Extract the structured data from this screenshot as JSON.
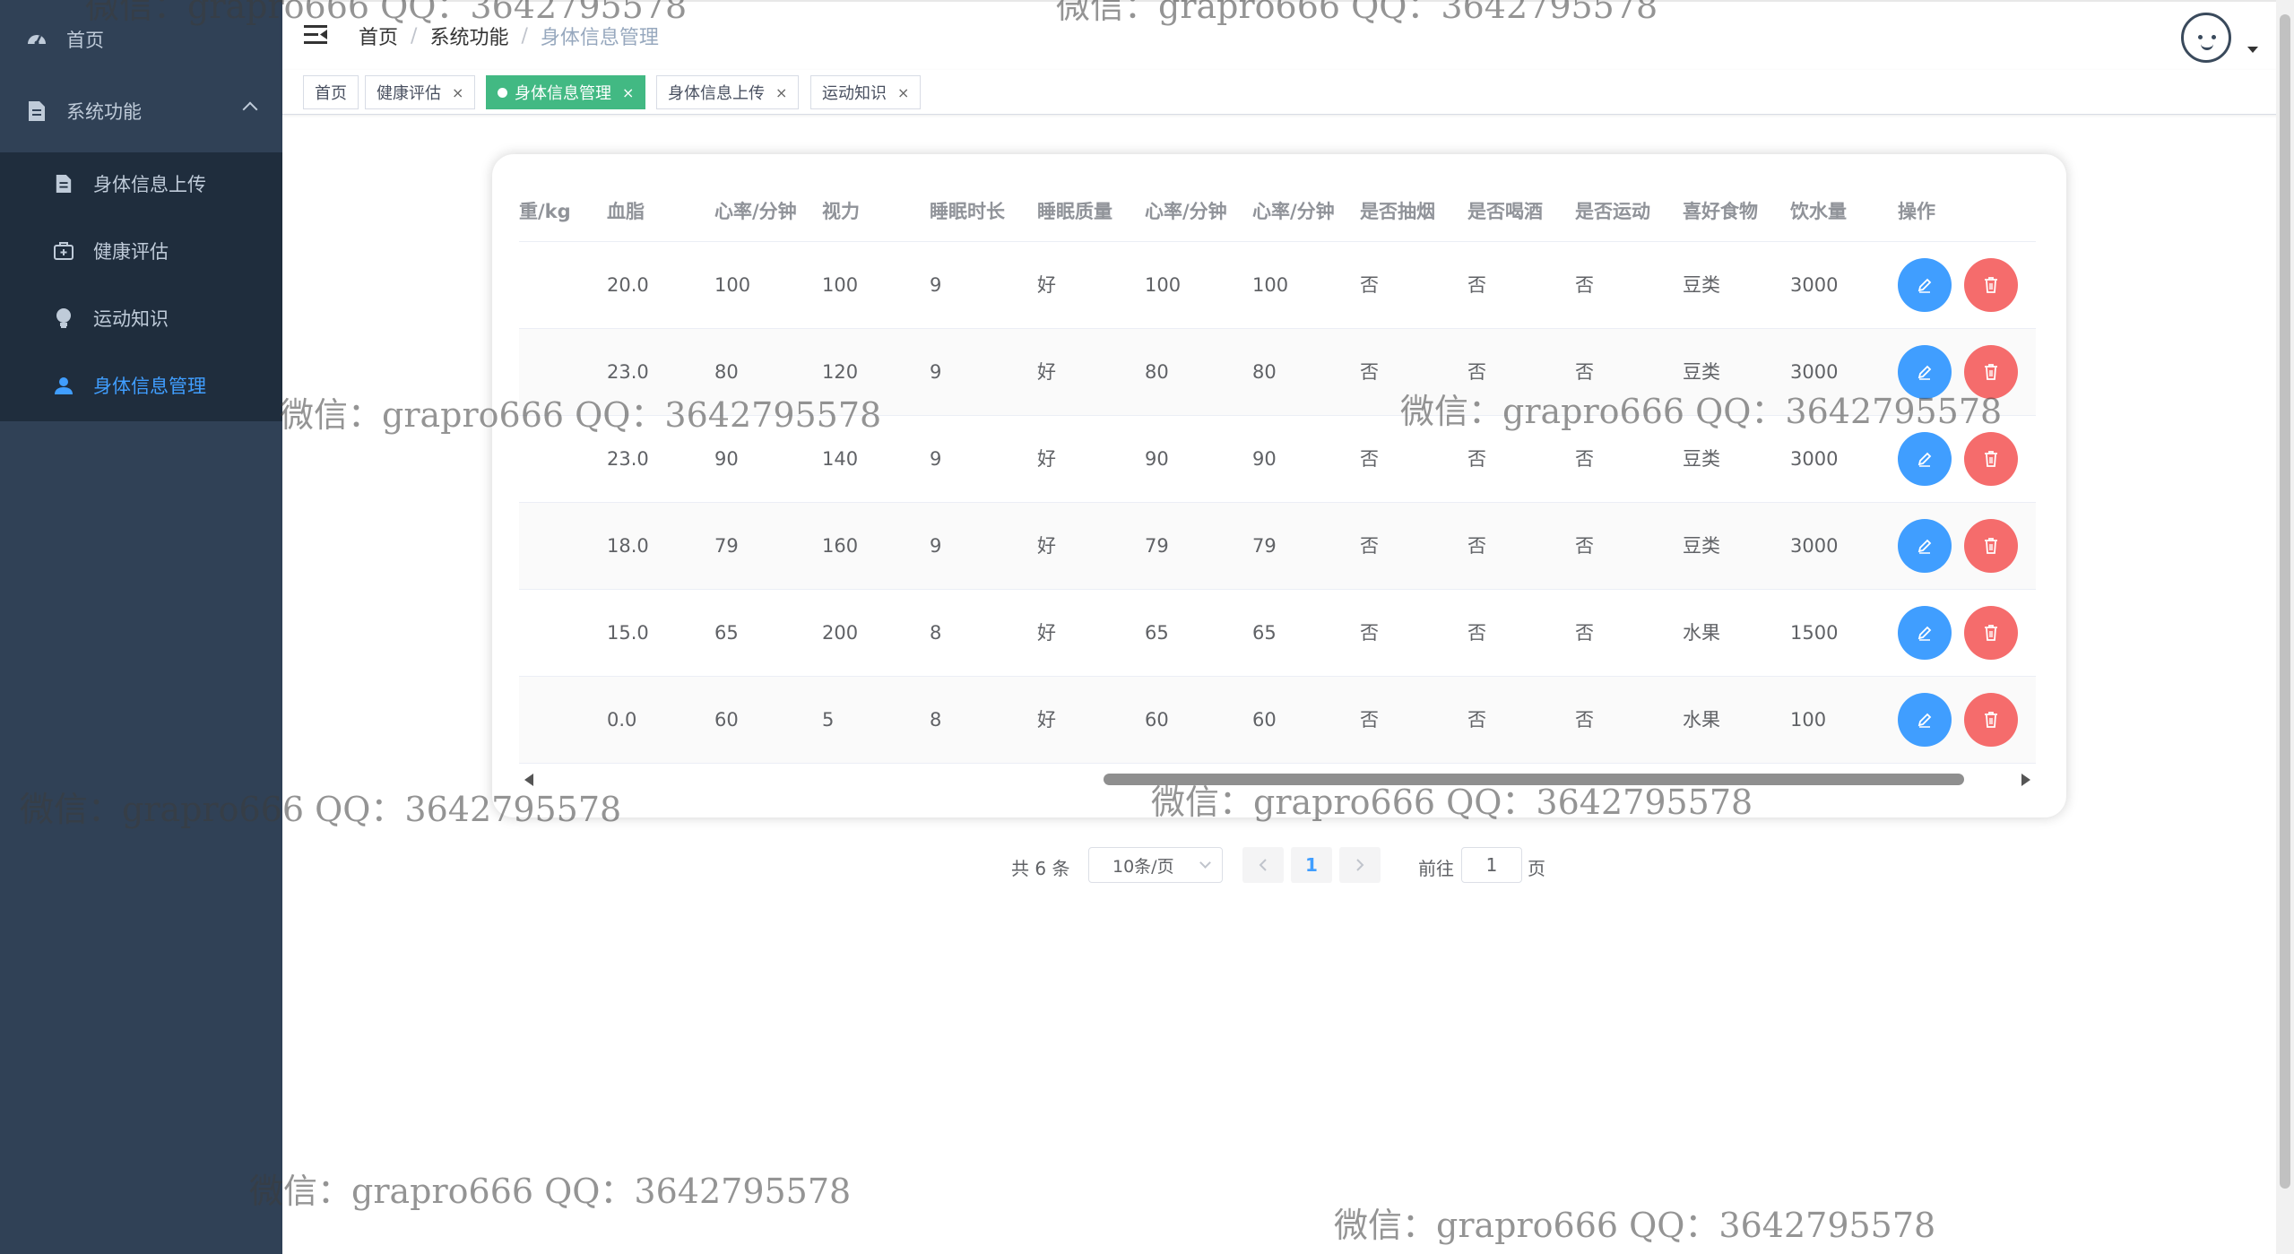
{
  "sidebar": {
    "items": [
      {
        "label": "首页",
        "icon": "dashboard-icon"
      },
      {
        "label": "系统功能",
        "icon": "document-icon",
        "expanded": true
      },
      {
        "label": "身体信息上传",
        "icon": "document-icon"
      },
      {
        "label": "健康评估",
        "icon": "medkit-icon"
      },
      {
        "label": "运动知识",
        "icon": "lightbulb-icon"
      },
      {
        "label": "身体信息管理",
        "icon": "user-icon",
        "active": true
      }
    ]
  },
  "breadcrumb": [
    "首页",
    "系统功能",
    "身体信息管理"
  ],
  "breadcrumb_sep": "/",
  "tags": [
    {
      "label": "首页",
      "close": ""
    },
    {
      "label": "健康评估",
      "close": "×"
    },
    {
      "label": "身体信息管理",
      "close": "×",
      "active": true
    },
    {
      "label": "身体信息上传",
      "close": "×"
    },
    {
      "label": "运动知识",
      "close": "×"
    }
  ],
  "table": {
    "columns": [
      "重/kg",
      "血脂",
      "心率/分钟",
      "视力",
      "睡眠时长",
      "睡眠质量",
      "心率/分钟",
      "心率/分钟",
      "是否抽烟",
      "是否喝酒",
      "是否运动",
      "喜好食物",
      "饮水量",
      "操作"
    ],
    "rows": [
      [
        "",
        "20.0",
        "100",
        "100",
        "9",
        "好",
        "100",
        "100",
        "否",
        "否",
        "否",
        "豆类",
        "3000"
      ],
      [
        "",
        "23.0",
        "80",
        "120",
        "9",
        "好",
        "80",
        "80",
        "否",
        "否",
        "否",
        "豆类",
        "3000"
      ],
      [
        "",
        "23.0",
        "90",
        "140",
        "9",
        "好",
        "90",
        "90",
        "否",
        "否",
        "否",
        "豆类",
        "3000"
      ],
      [
        "",
        "18.0",
        "79",
        "160",
        "9",
        "好",
        "79",
        "79",
        "否",
        "否",
        "否",
        "豆类",
        "3000"
      ],
      [
        "",
        "15.0",
        "65",
        "200",
        "8",
        "好",
        "65",
        "65",
        "否",
        "否",
        "否",
        "水果",
        "1500"
      ],
      [
        "",
        "0.0",
        "60",
        "5",
        "8",
        "好",
        "60",
        "60",
        "否",
        "否",
        "否",
        "水果",
        "100"
      ]
    ]
  },
  "pagination": {
    "total": "共 6 条",
    "page_size": "10条/页",
    "current": "1",
    "goto_label": "前往",
    "goto_value": "1",
    "page_suffix": "页"
  },
  "watermark": "微信：grapro666 QQ：3642795578",
  "colors": {
    "sidebar_bg": "#304156",
    "submenu_bg": "#1f2d3d",
    "active_menu": "#409eff",
    "active_tag": "#42b983",
    "edit_button": "#409eff",
    "delete_button": "#f56c6c"
  }
}
